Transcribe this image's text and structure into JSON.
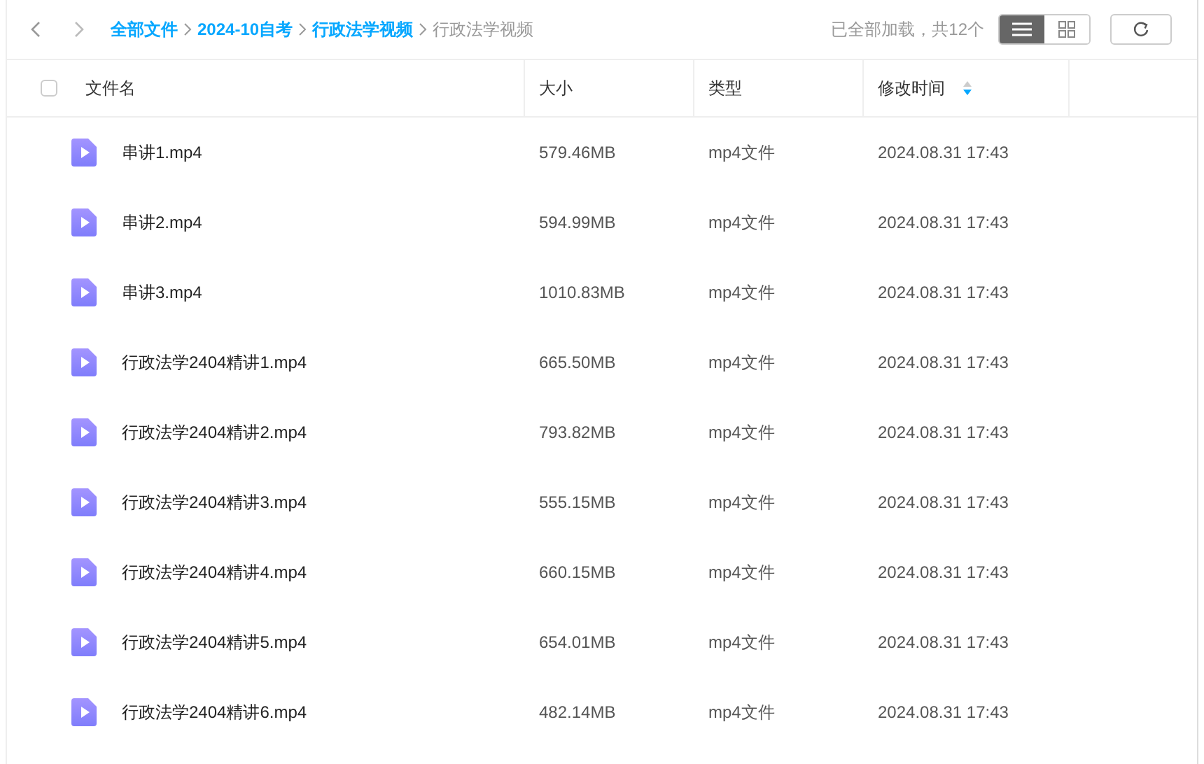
{
  "breadcrumb": [
    {
      "label": "全部文件",
      "current": false
    },
    {
      "label": "2024-10自考",
      "current": false
    },
    {
      "label": "行政法学视频",
      "current": false
    },
    {
      "label": "行政法学视频",
      "current": true
    }
  ],
  "status": "已全部加载，共12个",
  "views": [
    {
      "kind": "list",
      "selected": true
    },
    {
      "kind": "grid",
      "selected": false
    }
  ],
  "table": {
    "select_all": {
      "checked": false
    },
    "columns": [
      {
        "label": "文件名",
        "sorted": false
      },
      {
        "label": "大小",
        "sorted": false
      },
      {
        "label": "类型",
        "sorted": false
      },
      {
        "label": "修改时间",
        "sorted": true
      }
    ],
    "rows": [
      {
        "name": "串讲1.mp4",
        "size": "579.46MB",
        "type": "mp4文件",
        "modified": "2024.08.31 17:43"
      },
      {
        "name": "串讲2.mp4",
        "size": "594.99MB",
        "type": "mp4文件",
        "modified": "2024.08.31 17:43"
      },
      {
        "name": "串讲3.mp4",
        "size": "1010.83MB",
        "type": "mp4文件",
        "modified": "2024.08.31 17:43"
      },
      {
        "name": "行政法学2404精讲1.mp4",
        "size": "665.50MB",
        "type": "mp4文件",
        "modified": "2024.08.31 17:43"
      },
      {
        "name": "行政法学2404精讲2.mp4",
        "size": "793.82MB",
        "type": "mp4文件",
        "modified": "2024.08.31 17:43"
      },
      {
        "name": "行政法学2404精讲3.mp4",
        "size": "555.15MB",
        "type": "mp4文件",
        "modified": "2024.08.31 17:43"
      },
      {
        "name": "行政法学2404精讲4.mp4",
        "size": "660.15MB",
        "type": "mp4文件",
        "modified": "2024.08.31 17:43"
      },
      {
        "name": "行政法学2404精讲5.mp4",
        "size": "654.01MB",
        "type": "mp4文件",
        "modified": "2024.08.31 17:43"
      },
      {
        "name": "行政法学2404精讲6.mp4",
        "size": "482.14MB",
        "type": "mp4文件",
        "modified": "2024.08.31 17:43"
      }
    ]
  }
}
